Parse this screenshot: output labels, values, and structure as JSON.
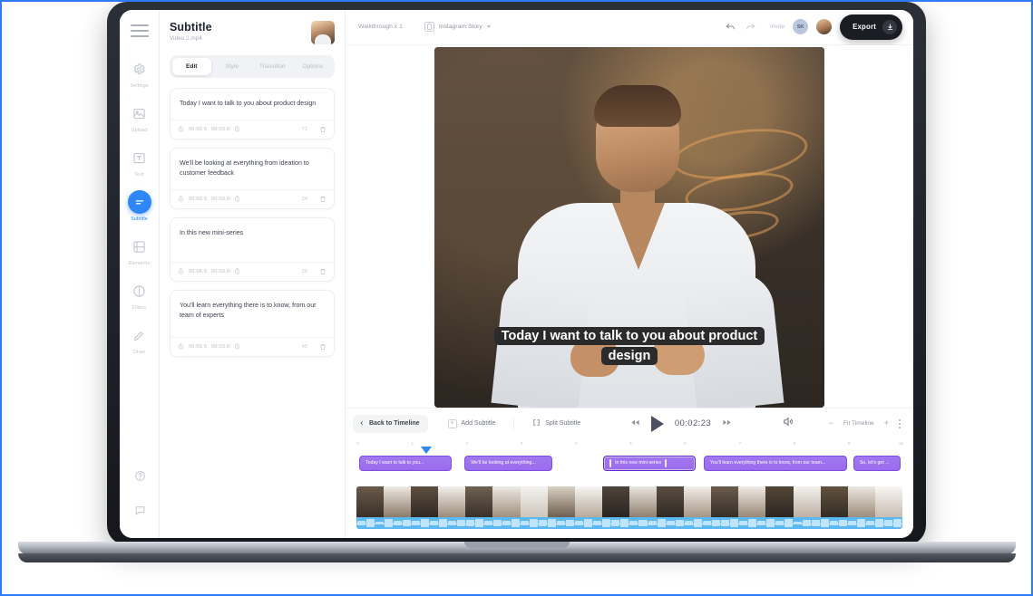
{
  "app": {
    "panel": {
      "title": "Subtitle",
      "file": "Video 2.mp4",
      "avatar_icon": "user-avatar",
      "tabs": [
        {
          "label": "Edit",
          "active": true
        },
        {
          "label": "Style",
          "active": false
        },
        {
          "label": "Transition",
          "active": false
        },
        {
          "label": "Options",
          "active": false
        }
      ],
      "cards": [
        {
          "text": "Today I want to talk to you about product design",
          "start": "00:00.0",
          "end": "00:03.0",
          "count": "71"
        },
        {
          "text": "We'll be looking at everything from ideation to customer feedback",
          "start": "00:03.0",
          "end": "00:03.0",
          "count": "24"
        },
        {
          "text": "In this new mini-series",
          "start": "00:06.0",
          "end": "00:03.0",
          "count": "29"
        },
        {
          "text": "You'll learn everything there is to know, from our team of experts",
          "start": "00:09.0",
          "end": "00:03.0",
          "count": "45"
        }
      ]
    },
    "rail": {
      "menu_icon": "hamburger-icon",
      "items": [
        {
          "label": "Settings",
          "icon": "gear-icon",
          "active": false
        },
        {
          "label": "Upload",
          "icon": "upload-image-icon",
          "active": false
        },
        {
          "label": "Text",
          "icon": "text-icon",
          "active": false
        },
        {
          "label": "Subtitle",
          "icon": "subtitle-icon",
          "active": true
        },
        {
          "label": "Elements",
          "icon": "elements-icon",
          "active": false
        },
        {
          "label": "Filters",
          "icon": "filters-icon",
          "active": false
        },
        {
          "label": "Draw",
          "icon": "pencil-icon",
          "active": false
        }
      ],
      "bottom": [
        {
          "label": "Help",
          "icon": "help-icon"
        },
        {
          "label": "Feedback",
          "icon": "chat-icon"
        }
      ]
    },
    "topbar": {
      "breadcrumb": "Walkthrough x 1",
      "project_icon": "story-format-icon",
      "project_name": "Instagram Story",
      "undo_icon": "undo-arrow-icon",
      "redo_icon": "redo-arrow-icon",
      "invite_label": "Invite",
      "avatar_initials": "SK",
      "export_label": "Export",
      "export_icon": "download-icon"
    },
    "video": {
      "caption": "Today I want to talk to you about product design"
    },
    "controls": {
      "back_label": "Back to Timeline",
      "back_icon": "chevron-left-icon",
      "add_label": "Add Subtitle",
      "add_icon": "plus-icon",
      "split_label": "Split Subtitle",
      "split_icon": "split-brackets-icon",
      "rewind_icon": "rewind-icon",
      "play_icon": "play-icon",
      "forward_icon": "fast-forward-icon",
      "timecode": "00:02:23",
      "volume_icon": "speaker-icon",
      "zoom_out": "−",
      "fit_label": "Fit Timeline",
      "zoom_in": "+",
      "more_icon": "kebab-menu-icon"
    },
    "timeline": {
      "ticks": [
        "0",
        "1",
        "2",
        "3",
        "4",
        "5",
        "6",
        "7",
        "8",
        "9",
        "10"
      ],
      "playhead_label": "playhead",
      "clips": [
        {
          "label": "Today I want to talk to you...",
          "left_pct": 0.5,
          "width_pct": 17.0,
          "selected": false
        },
        {
          "label": "We'll be looking at everything...",
          "left_pct": 19.8,
          "width_pct": 16.0,
          "selected": false
        },
        {
          "label": "In this new mini-series",
          "left_pct": 45.2,
          "width_pct": 17.0,
          "selected": true
        },
        {
          "label": "You'll learn everything there is to know, from our team...",
          "left_pct": 63.6,
          "width_pct": 26.2,
          "selected": false
        },
        {
          "label": "So, let's get ...",
          "left_pct": 91.0,
          "width_pct": 8.6,
          "selected": false
        }
      ]
    },
    "colors": {
      "accent": "#2f86f6",
      "clip": "#9b6ced",
      "clip_border": "#7c4fe0",
      "waveform": "#5bb8f2",
      "export_bg": "#1b1d24",
      "frame_border": "#2f7bf6"
    }
  }
}
